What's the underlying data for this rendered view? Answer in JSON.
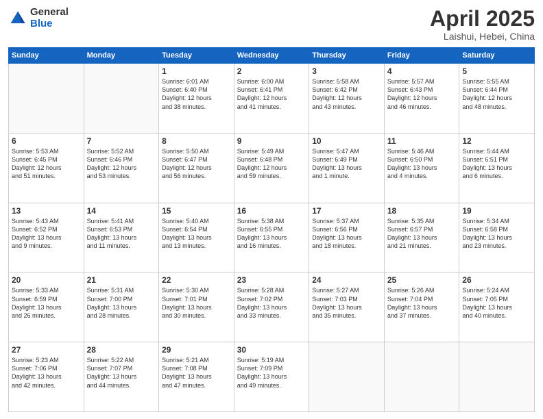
{
  "header": {
    "logo_general": "General",
    "logo_blue": "Blue",
    "month_title": "April 2025",
    "location": "Laishui, Hebei, China"
  },
  "days_of_week": [
    "Sunday",
    "Monday",
    "Tuesday",
    "Wednesday",
    "Thursday",
    "Friday",
    "Saturday"
  ],
  "weeks": [
    [
      {
        "day": "",
        "info": ""
      },
      {
        "day": "",
        "info": ""
      },
      {
        "day": "1",
        "info": "Sunrise: 6:01 AM\nSunset: 6:40 PM\nDaylight: 12 hours\nand 38 minutes."
      },
      {
        "day": "2",
        "info": "Sunrise: 6:00 AM\nSunset: 6:41 PM\nDaylight: 12 hours\nand 41 minutes."
      },
      {
        "day": "3",
        "info": "Sunrise: 5:58 AM\nSunset: 6:42 PM\nDaylight: 12 hours\nand 43 minutes."
      },
      {
        "day": "4",
        "info": "Sunrise: 5:57 AM\nSunset: 6:43 PM\nDaylight: 12 hours\nand 46 minutes."
      },
      {
        "day": "5",
        "info": "Sunrise: 5:55 AM\nSunset: 6:44 PM\nDaylight: 12 hours\nand 48 minutes."
      }
    ],
    [
      {
        "day": "6",
        "info": "Sunrise: 5:53 AM\nSunset: 6:45 PM\nDaylight: 12 hours\nand 51 minutes."
      },
      {
        "day": "7",
        "info": "Sunrise: 5:52 AM\nSunset: 6:46 PM\nDaylight: 12 hours\nand 53 minutes."
      },
      {
        "day": "8",
        "info": "Sunrise: 5:50 AM\nSunset: 6:47 PM\nDaylight: 12 hours\nand 56 minutes."
      },
      {
        "day": "9",
        "info": "Sunrise: 5:49 AM\nSunset: 6:48 PM\nDaylight: 12 hours\nand 59 minutes."
      },
      {
        "day": "10",
        "info": "Sunrise: 5:47 AM\nSunset: 6:49 PM\nDaylight: 13 hours\nand 1 minute."
      },
      {
        "day": "11",
        "info": "Sunrise: 5:46 AM\nSunset: 6:50 PM\nDaylight: 13 hours\nand 4 minutes."
      },
      {
        "day": "12",
        "info": "Sunrise: 5:44 AM\nSunset: 6:51 PM\nDaylight: 13 hours\nand 6 minutes."
      }
    ],
    [
      {
        "day": "13",
        "info": "Sunrise: 5:43 AM\nSunset: 6:52 PM\nDaylight: 13 hours\nand 9 minutes."
      },
      {
        "day": "14",
        "info": "Sunrise: 5:41 AM\nSunset: 6:53 PM\nDaylight: 13 hours\nand 11 minutes."
      },
      {
        "day": "15",
        "info": "Sunrise: 5:40 AM\nSunset: 6:54 PM\nDaylight: 13 hours\nand 13 minutes."
      },
      {
        "day": "16",
        "info": "Sunrise: 5:38 AM\nSunset: 6:55 PM\nDaylight: 13 hours\nand 16 minutes."
      },
      {
        "day": "17",
        "info": "Sunrise: 5:37 AM\nSunset: 6:56 PM\nDaylight: 13 hours\nand 18 minutes."
      },
      {
        "day": "18",
        "info": "Sunrise: 5:35 AM\nSunset: 6:57 PM\nDaylight: 13 hours\nand 21 minutes."
      },
      {
        "day": "19",
        "info": "Sunrise: 5:34 AM\nSunset: 6:58 PM\nDaylight: 13 hours\nand 23 minutes."
      }
    ],
    [
      {
        "day": "20",
        "info": "Sunrise: 5:33 AM\nSunset: 6:59 PM\nDaylight: 13 hours\nand 26 minutes."
      },
      {
        "day": "21",
        "info": "Sunrise: 5:31 AM\nSunset: 7:00 PM\nDaylight: 13 hours\nand 28 minutes."
      },
      {
        "day": "22",
        "info": "Sunrise: 5:30 AM\nSunset: 7:01 PM\nDaylight: 13 hours\nand 30 minutes."
      },
      {
        "day": "23",
        "info": "Sunrise: 5:28 AM\nSunset: 7:02 PM\nDaylight: 13 hours\nand 33 minutes."
      },
      {
        "day": "24",
        "info": "Sunrise: 5:27 AM\nSunset: 7:03 PM\nDaylight: 13 hours\nand 35 minutes."
      },
      {
        "day": "25",
        "info": "Sunrise: 5:26 AM\nSunset: 7:04 PM\nDaylight: 13 hours\nand 37 minutes."
      },
      {
        "day": "26",
        "info": "Sunrise: 5:24 AM\nSunset: 7:05 PM\nDaylight: 13 hours\nand 40 minutes."
      }
    ],
    [
      {
        "day": "27",
        "info": "Sunrise: 5:23 AM\nSunset: 7:06 PM\nDaylight: 13 hours\nand 42 minutes."
      },
      {
        "day": "28",
        "info": "Sunrise: 5:22 AM\nSunset: 7:07 PM\nDaylight: 13 hours\nand 44 minutes."
      },
      {
        "day": "29",
        "info": "Sunrise: 5:21 AM\nSunset: 7:08 PM\nDaylight: 13 hours\nand 47 minutes."
      },
      {
        "day": "30",
        "info": "Sunrise: 5:19 AM\nSunset: 7:09 PM\nDaylight: 13 hours\nand 49 minutes."
      },
      {
        "day": "",
        "info": ""
      },
      {
        "day": "",
        "info": ""
      },
      {
        "day": "",
        "info": ""
      }
    ]
  ]
}
